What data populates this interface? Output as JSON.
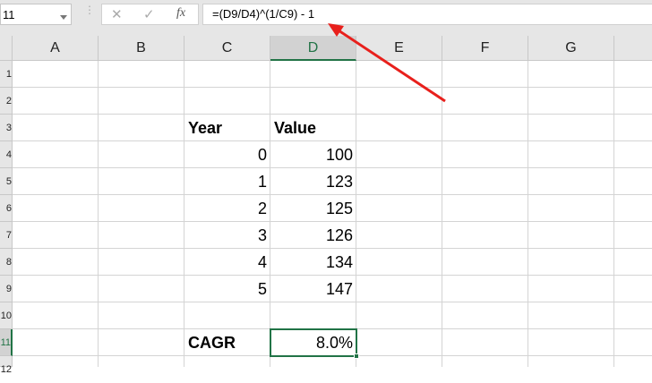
{
  "name_box": "11",
  "formula_bar": {
    "cancel_icon": "✕",
    "enter_icon": "✓",
    "fx_label": "fx",
    "formula": "=(D9/D4)^(1/C9) - 1"
  },
  "columns": [
    "A",
    "B",
    "C",
    "D",
    "E",
    "F",
    "G"
  ],
  "rows": [
    "1",
    "2",
    "3",
    "4",
    "5",
    "6",
    "7",
    "8",
    "9",
    "10",
    "11",
    "12"
  ],
  "selected_cell": "D11",
  "table": {
    "header_year": "Year",
    "header_value": "Value",
    "rows": [
      {
        "year": "0",
        "value": "100"
      },
      {
        "year": "1",
        "value": "123"
      },
      {
        "year": "2",
        "value": "125"
      },
      {
        "year": "3",
        "value": "126"
      },
      {
        "year": "4",
        "value": "134"
      },
      {
        "year": "5",
        "value": "147"
      }
    ]
  },
  "cagr_label": "CAGR",
  "cagr_value": "8.0%",
  "colors": {
    "accent": "#217346",
    "arrow": "#e8201c"
  }
}
